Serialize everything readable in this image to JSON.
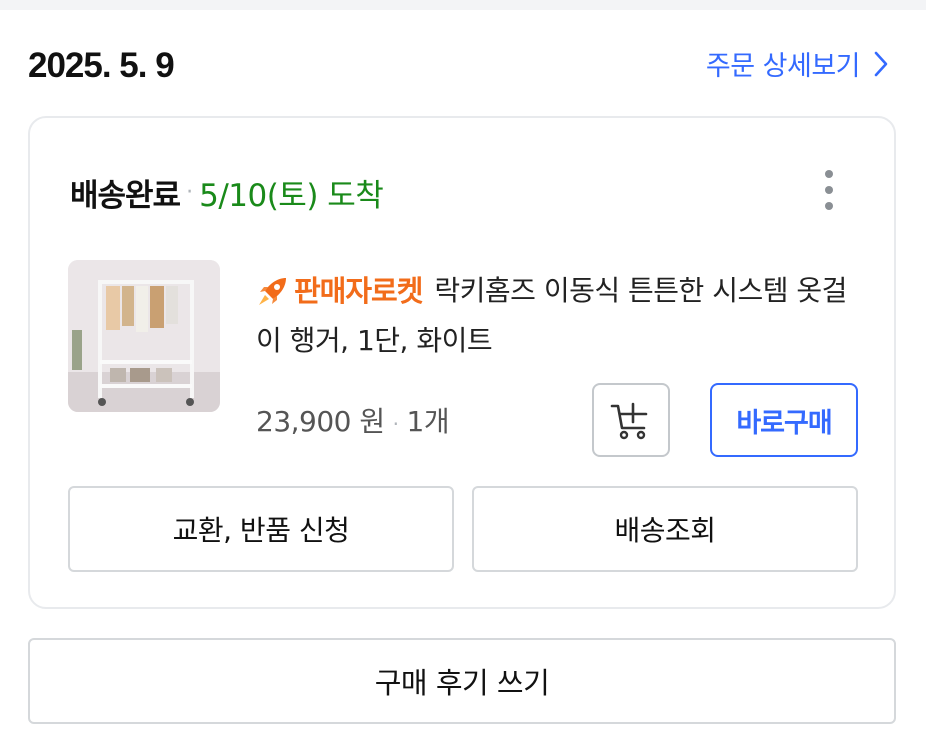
{
  "order": {
    "date": "2025. 5. 9",
    "detail_link": "주문 상세보기",
    "status": "배송완료",
    "arrival": "5/10(토) 도착"
  },
  "product": {
    "badge": "판매자로켓",
    "name": "락키홈즈 이동식 튼튼한 시스템 옷걸이 행거, 1단, 화이트",
    "image_icon": "clothes-rack-product-image",
    "price": "23,900 원",
    "quantity": "1개"
  },
  "buttons": {
    "cart_icon": "add-to-cart-icon",
    "buy_now": "바로구매",
    "exchange_return": "교환, 반품 신청",
    "track_delivery": "배송조회",
    "write_review": "구매 후기 쓰기"
  },
  "colors": {
    "accent_blue": "#346aff",
    "arrival_green": "#1a8a1a",
    "rocket_orange": "#f26c1a"
  }
}
